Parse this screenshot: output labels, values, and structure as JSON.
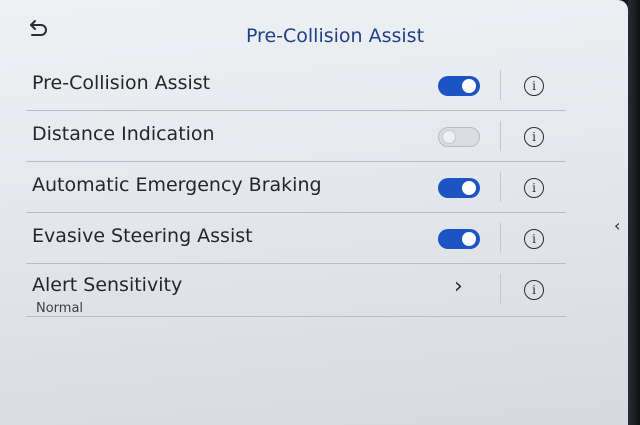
{
  "header": {
    "title": "Pre-Collision Assist",
    "back_icon": "back-arrow-icon"
  },
  "settings": [
    {
      "label": "Pre-Collision Assist",
      "control": "toggle",
      "state": "on"
    },
    {
      "label": "Distance Indication",
      "control": "toggle",
      "state": "off"
    },
    {
      "label": "Automatic Emergency Braking",
      "control": "toggle",
      "state": "on"
    },
    {
      "label": "Evasive Steering Assist",
      "control": "toggle",
      "state": "on"
    },
    {
      "label": "Alert Sensitivity",
      "value": "Normal",
      "control": "chevron"
    }
  ],
  "icons": {
    "info": "i",
    "chevron": "›",
    "side_arrow": "‹"
  },
  "colors": {
    "accent": "#1d54c4",
    "title": "#1f3f86"
  }
}
